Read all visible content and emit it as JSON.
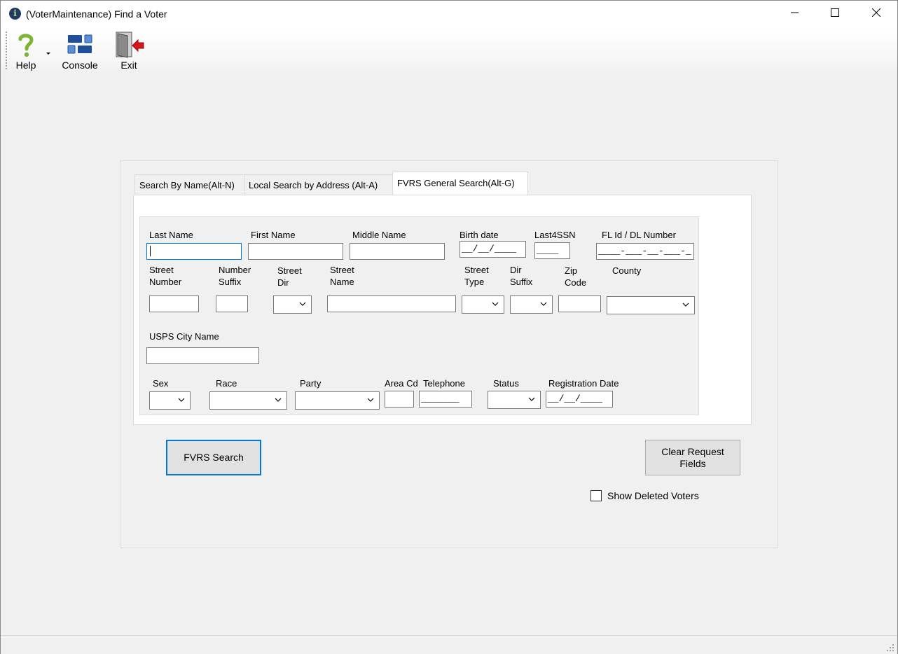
{
  "window": {
    "title": "(VoterMaintenance) Find a Voter",
    "controls": {
      "minimize": "minimize-icon",
      "maximize": "maximize-icon",
      "close": "close-icon"
    }
  },
  "toolbar": {
    "help_label": "Help",
    "console_label": "Console",
    "exit_label": "Exit"
  },
  "tabs": [
    {
      "label": "Search By Name(Alt-N)",
      "active": false
    },
    {
      "label": "Local Search by Address (Alt-A)",
      "active": false
    },
    {
      "label": "FVRS General Search(Alt-G)",
      "active": true
    }
  ],
  "form": {
    "labels": {
      "last_name": "Last Name",
      "first_name": "First Name",
      "middle_name": "Middle Name",
      "birth_date": "Birth date",
      "last4ssn": "Last4SSN",
      "fl_id": "FL Id / DL Number",
      "street_number": "Street\nNumber",
      "number_suffix": "Number\nSuffix",
      "street_dir": "Street\nDir",
      "street_name": "Street\nName",
      "street_type": "Street\nType",
      "dir_suffix": "Dir\nSuffix",
      "zip_code": "Zip\nCode",
      "county": "County",
      "usps_city": "USPS City Name",
      "sex": "Sex",
      "race": "Race",
      "party": "Party",
      "area_cd": "Area Cd",
      "telephone": "Telephone",
      "status": "Status",
      "registration_date": "Registration Date"
    },
    "values": {
      "last_name": "",
      "first_name": "",
      "middle_name": "",
      "birth_date": "__/__/____",
      "last4ssn": "____",
      "fl_id": "____-___-__-___-_",
      "street_number": "",
      "number_suffix": "",
      "street_name": "",
      "zip_code": "",
      "usps_city": "",
      "area_cd": "",
      "telephone": "_______",
      "registration_date": "__/__/____"
    }
  },
  "buttons": {
    "search": "FVRS Search",
    "clear": "Clear Request Fields"
  },
  "checkbox": {
    "show_deleted_label": "Show Deleted Voters",
    "checked": false
  },
  "colors": {
    "focus_border": "#0078d7",
    "help_icon": "#7cb534",
    "console_icon": "#1f4e9c",
    "exit_arrow": "#d7161c"
  }
}
